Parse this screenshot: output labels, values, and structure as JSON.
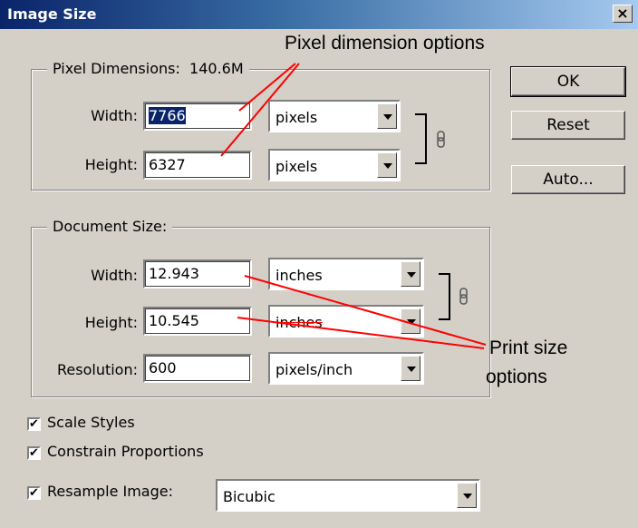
{
  "window": {
    "title": "Image Size",
    "close_label": "×"
  },
  "pixel_dimensions": {
    "label": "Pixel Dimensions:",
    "size": "140.6M",
    "width_label": "Width:",
    "width_value": "7766",
    "width_unit": "pixels",
    "height_label": "Height:",
    "height_value": "6327",
    "height_unit": "pixels"
  },
  "document_size": {
    "label": "Document Size:",
    "width_label": "Width:",
    "width_value": "12.943",
    "width_unit": "inches",
    "height_label": "Height:",
    "height_value": "10.545",
    "height_unit": "inches",
    "resolution_label": "Resolution:",
    "resolution_value": "600",
    "resolution_unit": "pixels/inch"
  },
  "buttons": {
    "ok": "OK",
    "reset": "Reset",
    "auto": "Auto..."
  },
  "options": {
    "scale_styles": {
      "label": "Scale Styles",
      "checked": true
    },
    "constrain_proportions": {
      "label": "Constrain Proportions",
      "checked": true
    },
    "resample_image": {
      "label": "Resample Image:",
      "checked": true,
      "method": "Bicubic"
    }
  },
  "annotations": {
    "pixel_options": "Pixel dimension options",
    "print_size_line1": "Print size",
    "print_size_line2": "options"
  },
  "colors": {
    "annotation_line": "#ff0000",
    "title_bar": "#0a246a"
  }
}
